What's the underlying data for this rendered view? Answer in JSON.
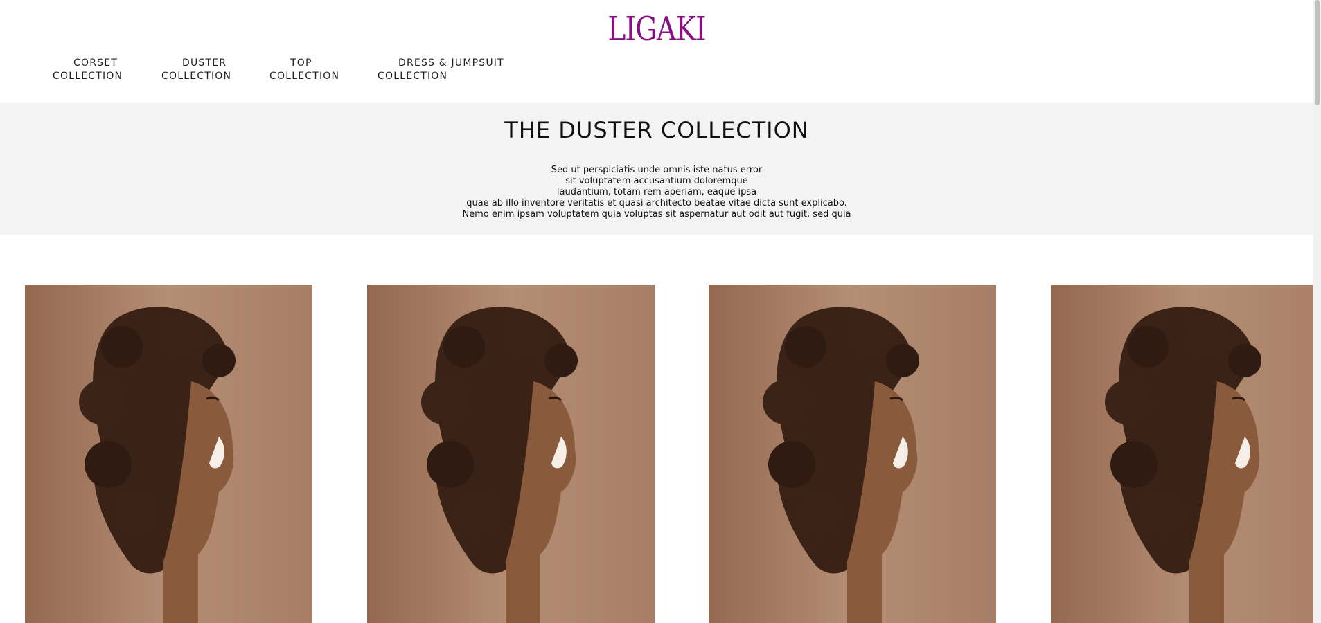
{
  "brand": {
    "logo_text": "LIGAKI",
    "logo_color": "#8b0d86"
  },
  "nav": {
    "items": [
      {
        "line1": "CORSET",
        "line2": "COLLECTION"
      },
      {
        "line1": "DUSTER",
        "line2": "COLLECTION"
      },
      {
        "line1": "TOP",
        "line2": "COLLECTION"
      },
      {
        "line1": "DRESS & JUMPSUIT",
        "line2": "COLLECTION"
      }
    ]
  },
  "banner": {
    "title": "THE DUSTER COLLECTION",
    "lines": [
      "Sed ut perspiciatis unde omnis iste natus error",
      "sit voluptatem accusantium doloremque",
      "laudantium, totam rem aperiam, eaque ipsa",
      "quae ab illo inventore veritatis et quasi architecto beatae vitae dicta sunt explicabo.",
      "Nemo enim ipsam voluptatem quia voluptas sit aspernatur aut odit aut fugit, sed quia"
    ],
    "background": "#f3f3f3"
  },
  "products": {
    "count": 4,
    "image_subject": "smiling woman with curly hair profile"
  }
}
